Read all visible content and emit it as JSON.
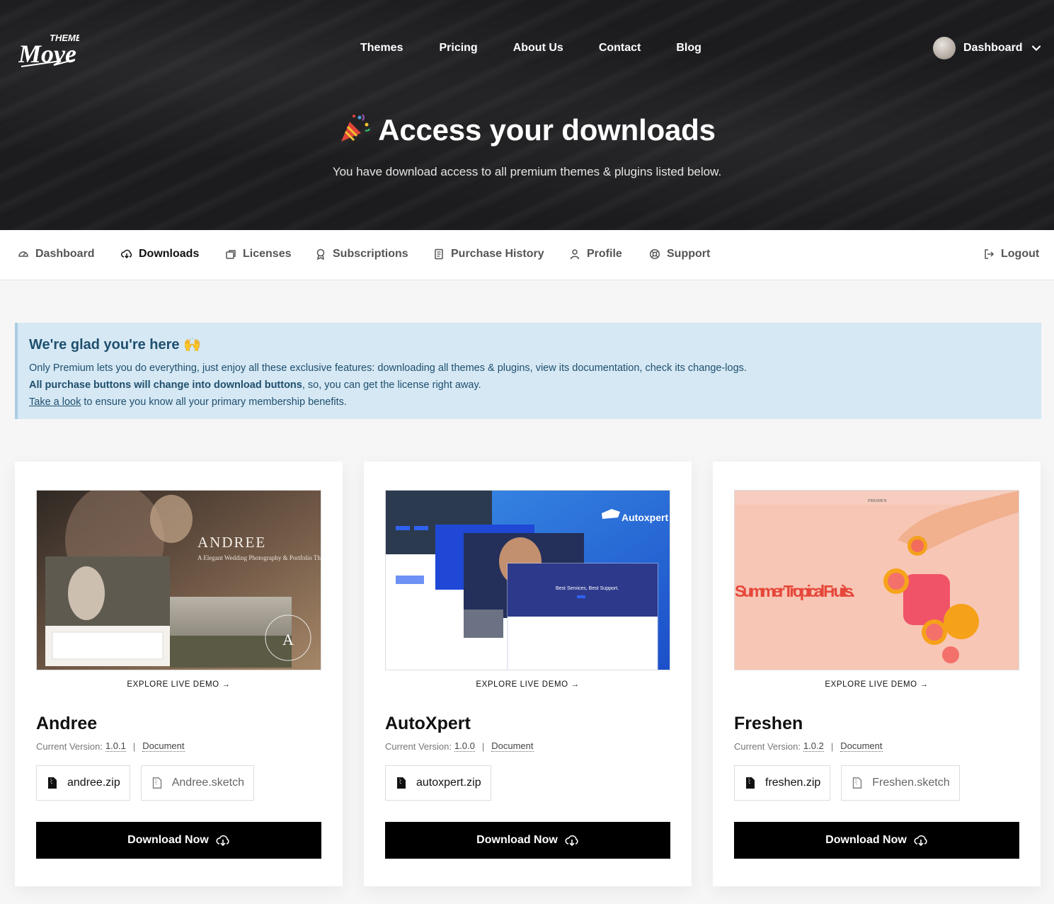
{
  "brand": {
    "logo_text_top": "THEME",
    "logo_text_main": "Move"
  },
  "topnav": [
    "Themes",
    "Pricing",
    "About Us",
    "Contact",
    "Blog"
  ],
  "user_menu": {
    "label": "Dashboard"
  },
  "hero": {
    "title": "Access your downloads",
    "subtitle": "You have download access to all premium themes & plugins listed below."
  },
  "tabs": [
    {
      "label": "Dashboard",
      "icon": "dashboard-icon"
    },
    {
      "label": "Downloads",
      "icon": "cloud-download-icon",
      "active": true
    },
    {
      "label": "Licenses",
      "icon": "key-icon"
    },
    {
      "label": "Subscriptions",
      "icon": "badge-icon"
    },
    {
      "label": "Purchase History",
      "icon": "receipt-icon"
    },
    {
      "label": "Profile",
      "icon": "user-icon"
    },
    {
      "label": "Support",
      "icon": "lifebuoy-icon"
    }
  ],
  "logout": {
    "label": "Logout",
    "icon": "logout-icon"
  },
  "notice": {
    "title": "We're glad you're here 🙌",
    "line1": "Only Premium lets you do everything, just enjoy all these exclusive features: downloading all themes & plugins, view its documentation, check its change-logs.",
    "line2_bold": "All purchase buttons will change into download buttons",
    "line2_rest": ", so, you can get the license right away.",
    "line3_link": "Take a look",
    "line3_rest": " to ensure you know all your primary membership benefits."
  },
  "cards": [
    {
      "name": "Andree",
      "thumb_heading": "ANDREE",
      "thumb_sub": "A Elegant Wedding Photography & Portfolio Theme",
      "explore": "EXPLORE LIVE DEMO",
      "version_label": "Current Version:",
      "version": "1.0.1",
      "doc": "Document",
      "files": [
        "andree.zip",
        "Andree.sketch"
      ],
      "button": "Download Now"
    },
    {
      "name": "AutoXpert",
      "thumb_heading": "Autoxpert",
      "thumb_sub": "Best Services, Best Support.",
      "explore": "EXPLORE LIVE DEMO",
      "version_label": "Current Version:",
      "version": "1.0.0",
      "doc": "Document",
      "files": [
        "autoxpert.zip"
      ],
      "button": "Download Now"
    },
    {
      "name": "Freshen",
      "thumb_heading": "Summer Tropical Fruits.",
      "thumb_sub": "FRESHEN",
      "explore": "EXPLORE LIVE DEMO",
      "version_label": "Current Version:",
      "version": "1.0.2",
      "doc": "Document",
      "files": [
        "freshen.zip",
        "Freshen.sketch"
      ],
      "button": "Download Now"
    }
  ]
}
